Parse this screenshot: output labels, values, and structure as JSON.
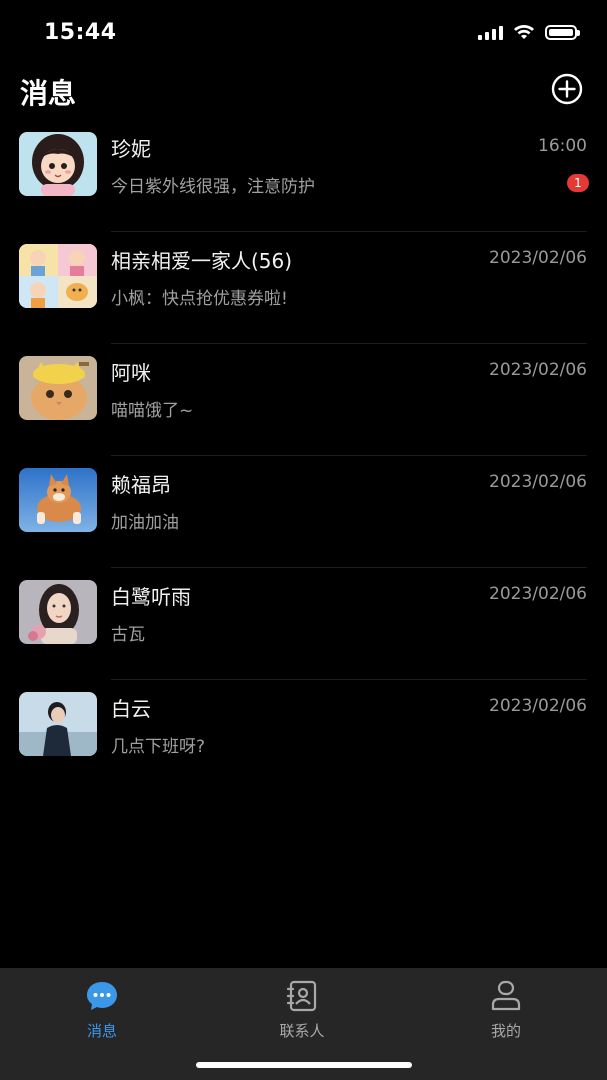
{
  "status_bar": {
    "time": "15:44"
  },
  "header": {
    "title": "消息",
    "add_icon": "plus-circle-icon"
  },
  "chats": [
    {
      "name": "珍妮",
      "time": "16:00",
      "preview": "今日紫外线很强，注意防护",
      "unread": "1",
      "avatar": "cartoon-girl-avatar"
    },
    {
      "name": "相亲相爱一家人(56)",
      "time": "2023/02/06",
      "preview": "小枫：快点抢优惠券啦!",
      "avatar": "group-collage-avatar"
    },
    {
      "name": "阿咪",
      "time": "2023/02/06",
      "preview": "喵喵饿了~",
      "avatar": "cat-avatar"
    },
    {
      "name": "赖福昂",
      "time": "2023/02/06",
      "preview": "加油加油",
      "avatar": "dog-avatar"
    },
    {
      "name": "白鹭听雨",
      "time": "2023/02/06",
      "preview": "古瓦",
      "avatar": "woman-photo-avatar"
    },
    {
      "name": "白云",
      "time": "2023/02/06",
      "preview": "几点下班呀?",
      "avatar": "man-photo-avatar"
    }
  ],
  "tabs": [
    {
      "label": "消息",
      "icon": "chat-bubble-icon",
      "active": true
    },
    {
      "label": "联系人",
      "icon": "contacts-icon",
      "active": false
    },
    {
      "label": "我的",
      "icon": "profile-icon",
      "active": false
    }
  ],
  "colors": {
    "background": "#000000",
    "tab_bar": "#262626",
    "accent": "#3b97e8",
    "badge": "#e53935"
  }
}
